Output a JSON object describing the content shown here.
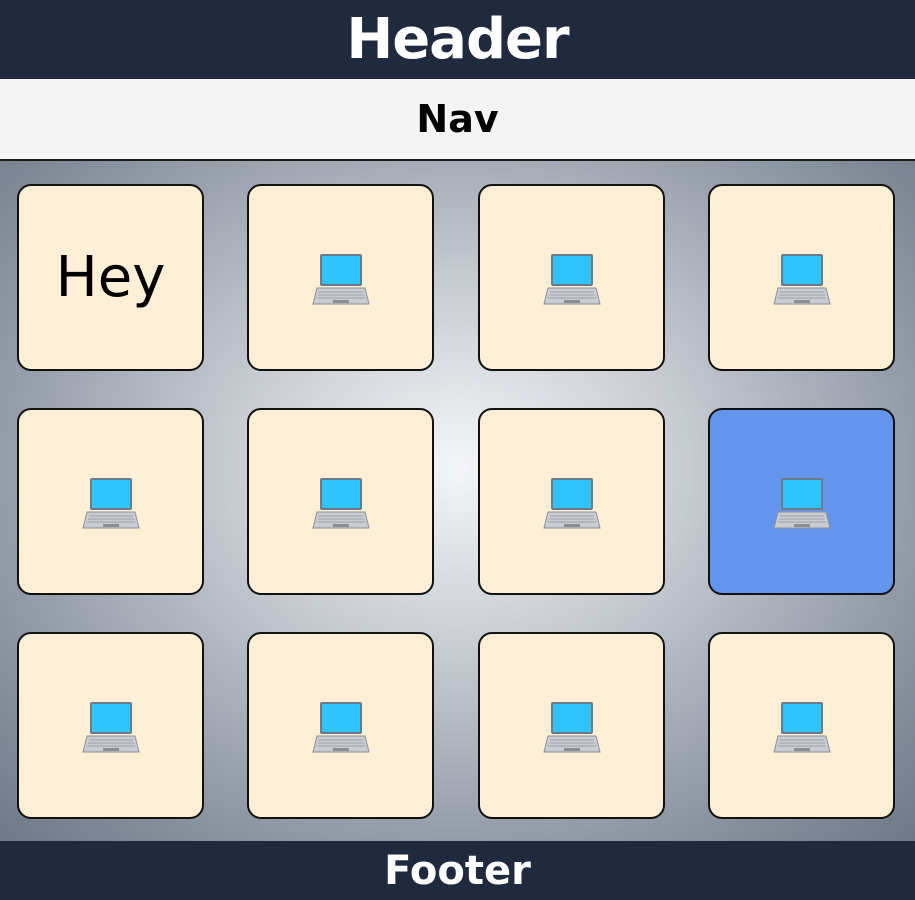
{
  "header": {
    "title": "Header"
  },
  "nav": {
    "label": "Nav"
  },
  "footer": {
    "label": "Footer"
  },
  "grid": {
    "tiles": [
      {
        "text": "Hey",
        "icon": null,
        "selected": false
      },
      {
        "text": "",
        "icon": "laptop-icon",
        "selected": false
      },
      {
        "text": "",
        "icon": "laptop-icon",
        "selected": false
      },
      {
        "text": "",
        "icon": "laptop-icon",
        "selected": false
      },
      {
        "text": "",
        "icon": "laptop-icon",
        "selected": false
      },
      {
        "text": "",
        "icon": "laptop-icon",
        "selected": false
      },
      {
        "text": "",
        "icon": "laptop-icon",
        "selected": false
      },
      {
        "text": "",
        "icon": "laptop-icon",
        "selected": true
      },
      {
        "text": "",
        "icon": "laptop-icon",
        "selected": false
      },
      {
        "text": "",
        "icon": "laptop-icon",
        "selected": false
      },
      {
        "text": "",
        "icon": "laptop-icon",
        "selected": false
      },
      {
        "text": "",
        "icon": "laptop-icon",
        "selected": false
      }
    ]
  },
  "colors": {
    "header_bg": "#1f2a3e",
    "tile_bg": "#ffefd6",
    "tile_selected_bg": "#6495ed"
  }
}
